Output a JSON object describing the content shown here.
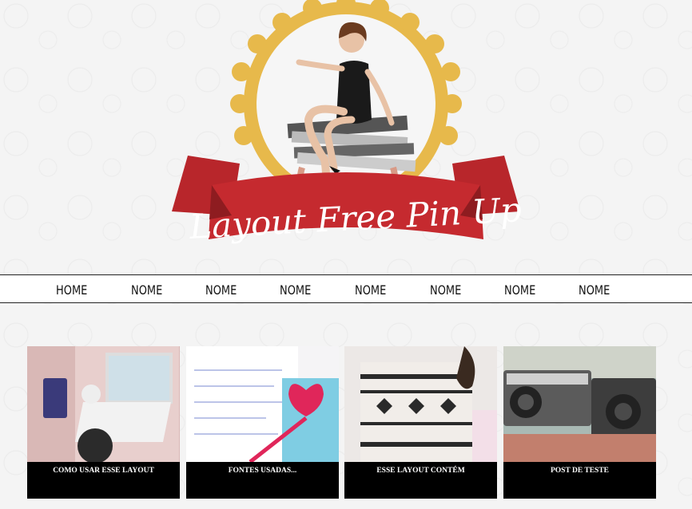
{
  "logo": {
    "title": "Layout Free Pin Up"
  },
  "nav": {
    "items": [
      "HOME",
      "NOME",
      "NOME",
      "NOME",
      "NOME",
      "NOME",
      "NOME",
      "NOME"
    ]
  },
  "posts": [
    {
      "title": "COMO USAR ESSE LAYOUT"
    },
    {
      "title": "FONTES USADAS..."
    },
    {
      "title": "ESSE LAYOUT CONTÉM"
    },
    {
      "title": "POST DE TESTE"
    }
  ],
  "colors": {
    "ribbon": "#c0282d",
    "ring": "#e6b84a",
    "caption_bg": "#000000"
  }
}
